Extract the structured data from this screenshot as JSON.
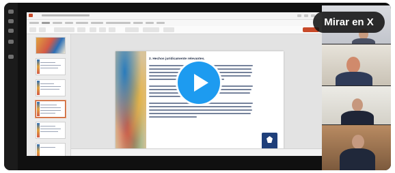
{
  "video_overlay": {
    "mirar_label": "Mirar en X",
    "accent": "#1d9bf0"
  },
  "slide": {
    "heading": "2. Hechos jurídicamente relevantes."
  },
  "icons": {
    "play": "play-icon",
    "logo": "fiscalia-logo-icon"
  }
}
